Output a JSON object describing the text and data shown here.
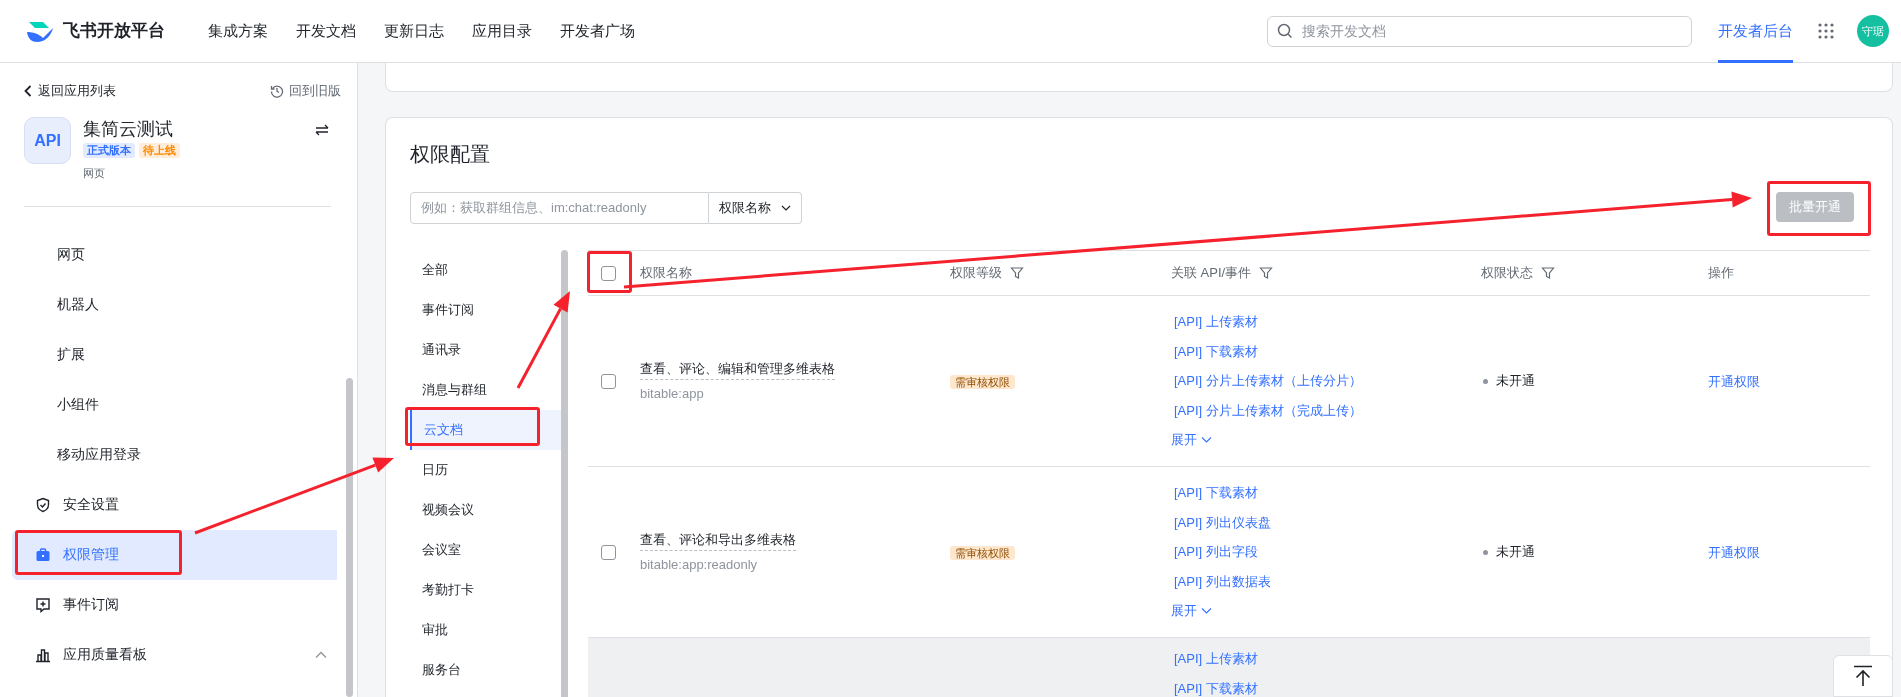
{
  "header": {
    "logo_text": "飞书开放平台",
    "nav": [
      {
        "label": "集成方案",
        "selected": false
      },
      {
        "label": "开发文档",
        "selected": false
      },
      {
        "label": "更新日志",
        "selected": false
      },
      {
        "label": "应用目录",
        "selected": false
      },
      {
        "label": "开发者广场",
        "selected": false
      }
    ],
    "search": {
      "placeholder": "搜索开发文档"
    },
    "console_link": {
      "label": "开发者后台",
      "selected": true
    },
    "avatar": "守琚"
  },
  "sidebar": {
    "back": "返回应用列表",
    "old_version": "回到旧版",
    "app": {
      "icon_text": "API",
      "name": "集简云测试",
      "tags": [
        {
          "label": "正式版本",
          "color": "#3370ff"
        },
        {
          "label": "待上线",
          "color": "#ff8800"
        }
      ],
      "type": "网页"
    },
    "items": [
      {
        "kind": "sub",
        "label": "网页",
        "selected": false
      },
      {
        "kind": "sub",
        "label": "机器人",
        "selected": false
      },
      {
        "kind": "sub",
        "label": "扩展",
        "selected": false
      },
      {
        "kind": "sub",
        "label": "小组件",
        "selected": false
      },
      {
        "kind": "sub",
        "label": "移动应用登录",
        "selected": false
      },
      {
        "kind": "section",
        "label": "安全设置",
        "selected": false
      },
      {
        "kind": "section",
        "label": "权限管理",
        "selected": true
      },
      {
        "kind": "section",
        "label": "事件订阅",
        "selected": false
      },
      {
        "kind": "section",
        "label": "应用质量看板",
        "selected": false,
        "expanded": true
      }
    ]
  },
  "panel": {
    "title": "权限配置",
    "search": {
      "placeholder": "例如：获取群组信息、im:chat:readonly",
      "scope": "权限名称"
    },
    "batch_button": {
      "label": "批量开通",
      "disabled": true
    },
    "categories": [
      {
        "label": "全部",
        "selected": false
      },
      {
        "label": "事件订阅",
        "selected": false
      },
      {
        "label": "通讯录",
        "selected": false
      },
      {
        "label": "消息与群组",
        "selected": false
      },
      {
        "label": "云文档",
        "selected": true
      },
      {
        "label": "日历",
        "selected": false
      },
      {
        "label": "视频会议",
        "selected": false
      },
      {
        "label": "会议室",
        "selected": false
      },
      {
        "label": "考勤打卡",
        "selected": false
      },
      {
        "label": "审批",
        "selected": false
      },
      {
        "label": "服务台",
        "selected": false
      }
    ],
    "table": {
      "select_all_checked": false,
      "columns": [
        {
          "label": "权限名称",
          "filter": false
        },
        {
          "label": "权限等级",
          "filter": true
        },
        {
          "label": "关联 API/事件",
          "filter": true
        },
        {
          "label": "权限状态",
          "filter": true
        },
        {
          "label": "操作",
          "filter": false
        }
      ],
      "rows": [
        {
          "checked": false,
          "highlighted": false,
          "name": "查看、评论、编辑和管理多维表格",
          "code": "bitable:app",
          "level": "需审核权限",
          "apis": [
            "[API] 上传素材",
            "[API] 下载素材",
            "[API] 分片上传素材（上传分片）",
            "[API] 分片上传素材（完成上传）"
          ],
          "expand": "展开",
          "status": "未开通",
          "action": "开通权限"
        },
        {
          "checked": false,
          "highlighted": false,
          "name": "查看、评论和导出多维表格",
          "code": "bitable:app:readonly",
          "level": "需审核权限",
          "apis": [
            "[API] 下载素材",
            "[API] 列出仪表盘",
            "[API] 列出字段",
            "[API] 列出数据表"
          ],
          "expand": "展开",
          "status": "未开通",
          "action": "开通权限"
        },
        {
          "highlighted": true,
          "apis": [
            "[API] 上传素材",
            "[API] 下载素材"
          ]
        }
      ]
    }
  }
}
